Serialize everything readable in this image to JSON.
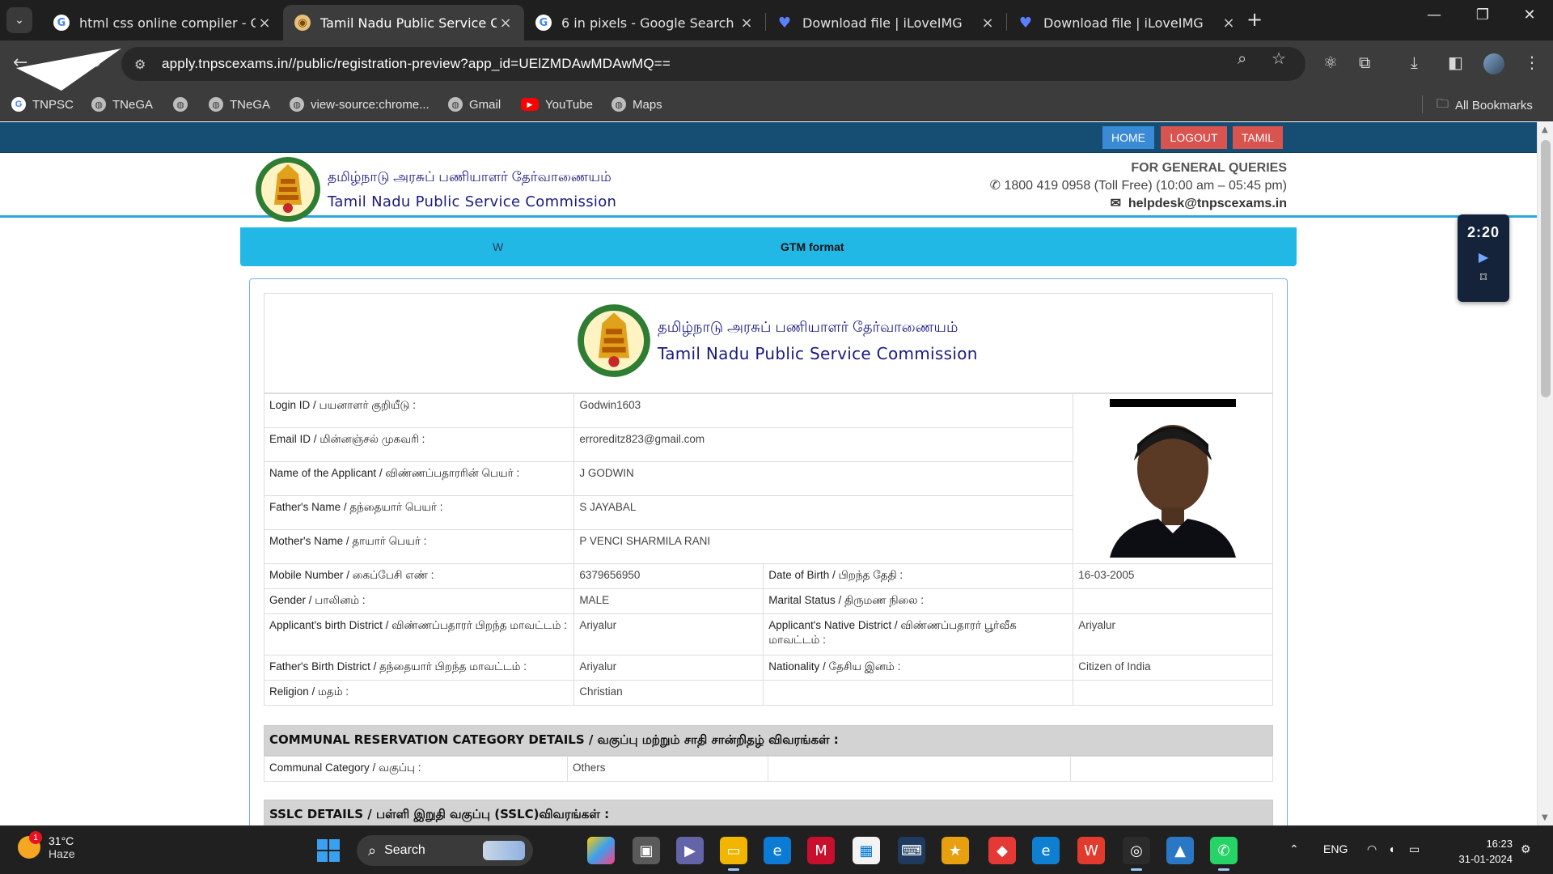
{
  "browser": {
    "tabs": [
      {
        "title": "html css online compiler - Goog",
        "favicon": "google-icon",
        "active": false
      },
      {
        "title": "Tamil Nadu Public Service Comm",
        "favicon": "tnpsc-icon",
        "active": true
      },
      {
        "title": "6 in pixels - Google Search",
        "favicon": "google-icon",
        "active": false
      },
      {
        "title": "Download file | iLoveIMG",
        "favicon": "ilovemg-icon",
        "active": false
      },
      {
        "title": "Download file | iLoveIMG",
        "favicon": "ilovemg-icon",
        "active": false
      }
    ],
    "url": "apply.tnpscexams.in//public/registration-preview?app_id=UElZMDAwMDAwMQ==",
    "bookmarks": [
      {
        "label": "TNPSC",
        "icon": "google-icon"
      },
      {
        "label": "TNeGA",
        "icon": "globe-icon"
      },
      {
        "label": "",
        "icon": "globe-icon"
      },
      {
        "label": "TNeGA",
        "icon": "globe-icon"
      },
      {
        "label": "view-source:chrome...",
        "icon": "globe-icon"
      },
      {
        "label": "Gmail",
        "icon": "globe-icon"
      },
      {
        "label": "YouTube",
        "icon": "youtube-icon"
      },
      {
        "label": "Maps",
        "icon": "globe-icon"
      }
    ],
    "all_bookmarks": "All Bookmarks"
  },
  "site": {
    "nav": {
      "home": "HOME",
      "logout": "LOGOUT",
      "tamil": "TAMIL"
    },
    "org_tamil": "தமிழ்நாடு அரசுப் பணியாளர் தேர்வாணையம்",
    "org_english": "Tamil Nadu Public Service Commission",
    "queries_title": "FOR GENERAL QUERIES",
    "phone": "1800 419 0958 (Toll Free)  (10:00 am – 05:45 pm)",
    "email": "helpdesk@tnpscexams.in",
    "marquee_a": "W",
    "marquee_b": "GTM format",
    "timer": "2:20"
  },
  "form": {
    "rows_top": [
      {
        "label": "Login ID / பயனாளர் குறியீடு :",
        "value": "Godwin1603"
      },
      {
        "label": "Email ID / மின்னஞ்சல் முகவரி :",
        "value": "erroreditz823@gmail.com"
      },
      {
        "label": "Name of the Applicant / விண்ணப்பதாரரின் பெயர் :",
        "value": "J GODWIN"
      },
      {
        "label": "Father's Name / தந்தையார் பெயர் :",
        "value": "S JAYABAL"
      },
      {
        "label": "Mother's Name / தாயார் பெயர் :",
        "value": "P VENCI SHARMILA RANI"
      }
    ],
    "rows_pair": [
      {
        "l1": "Mobile Number / கைப்பேசி எண் :",
        "v1": "6379656950",
        "l2": "Date of Birth / பிறந்த தேதி :",
        "v2": "16-03-2005"
      },
      {
        "l1": "Gender / பாலினம் :",
        "v1": "MALE",
        "l2": "Marital Status / திருமண நிலை :",
        "v2": ""
      },
      {
        "l1": "Applicant's birth District / விண்ணப்பதாரர் பிறந்த மாவட்டம் :",
        "v1": "Ariyalur",
        "l2": "Applicant's Native District / விண்ணப்பதாரர் பூர்வீக மாவட்டம் :",
        "v2": "Ariyalur"
      },
      {
        "l1": "Father's Birth District / தந்தையார் பிறந்த மாவட்டம் :",
        "v1": "Ariyalur",
        "l2": "Nationality / தேசிய இனம் :",
        "v2": "Citizen of India"
      },
      {
        "l1": "Religion / மதம் :",
        "v1": "Christian",
        "l2": "",
        "v2": ""
      }
    ],
    "communal_section": "COMMUNAL RESERVATION CATEGORY DETAILS / வகுப்பு மற்றும் சாதி சான்றிதழ் விவரங்கள் :",
    "communal_label": "Communal Category / வகுப்பு :",
    "communal_value": "Others",
    "sslc_section": "SSLC DETAILS / பள்ளி இறுதி வகுப்பு (SSLC)விவரங்கள் :"
  },
  "taskbar": {
    "temp": "31°C",
    "weather": "Haze",
    "badge": "1",
    "search": "Search",
    "lang": "ENG",
    "time": "16:23",
    "date": "31-01-2024"
  }
}
